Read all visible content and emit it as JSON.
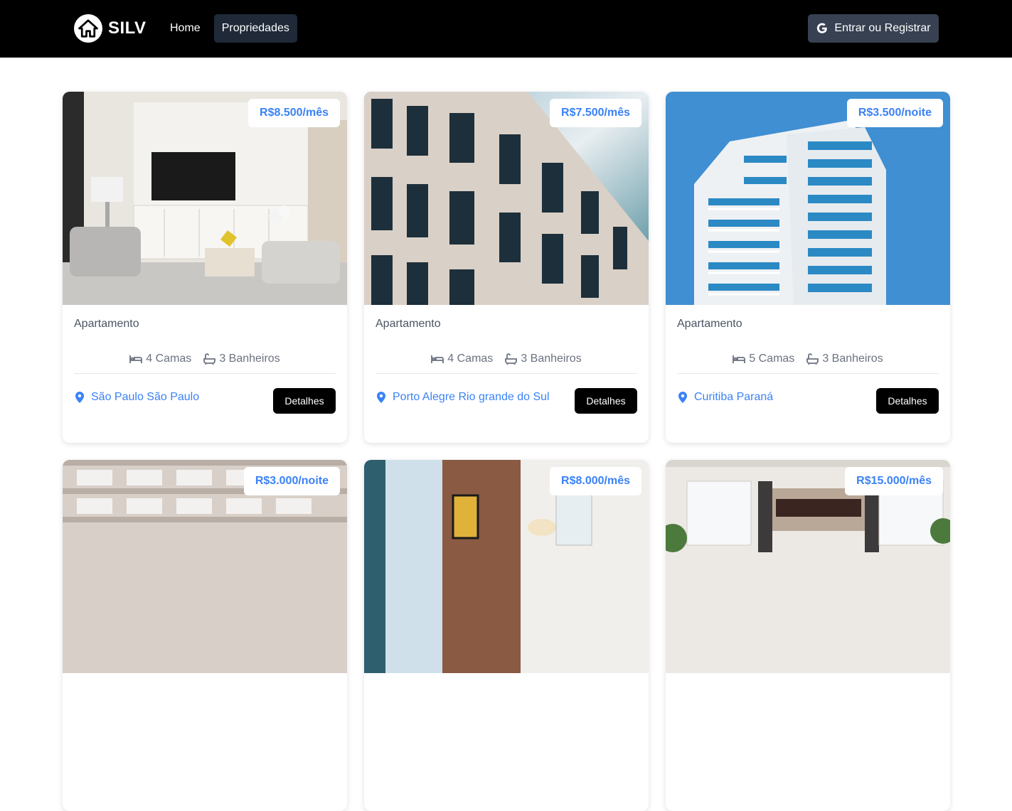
{
  "nav": {
    "brand": "SILV",
    "links": [
      {
        "label": "Home",
        "active": false
      },
      {
        "label": "Propriedades",
        "active": true
      }
    ],
    "login_label": "Entrar ou Registrar"
  },
  "colors": {
    "navbar_bg": "#000000",
    "accent": "#3b82f6",
    "button_bg": "#000000",
    "login_bg": "#374151"
  },
  "properties": [
    {
      "price": "R$8.500/mês",
      "type": "Apartamento",
      "beds": "4 Camas",
      "baths": "3 Banheiros",
      "location": "São Paulo São Paulo",
      "details_label": "Detalhes",
      "image": "living-room"
    },
    {
      "price": "R$7.500/mês",
      "type": "Apartamento",
      "beds": "4 Camas",
      "baths": "3 Banheiros",
      "location": "Porto Alegre Rio grande do Sul",
      "details_label": "Detalhes",
      "image": "building-facade"
    },
    {
      "price": "R$3.500/noite",
      "type": "Apartamento",
      "beds": "5 Camas",
      "baths": "3 Banheiros",
      "location": "Curitiba Paraná",
      "details_label": "Detalhes",
      "image": "tower-blue"
    },
    {
      "price": "R$3.000/noite",
      "image": "balcony-facade"
    },
    {
      "price": "R$8.000/mês",
      "image": "loft-brick"
    },
    {
      "price": "R$15.000/mês",
      "image": "living-windows"
    }
  ]
}
